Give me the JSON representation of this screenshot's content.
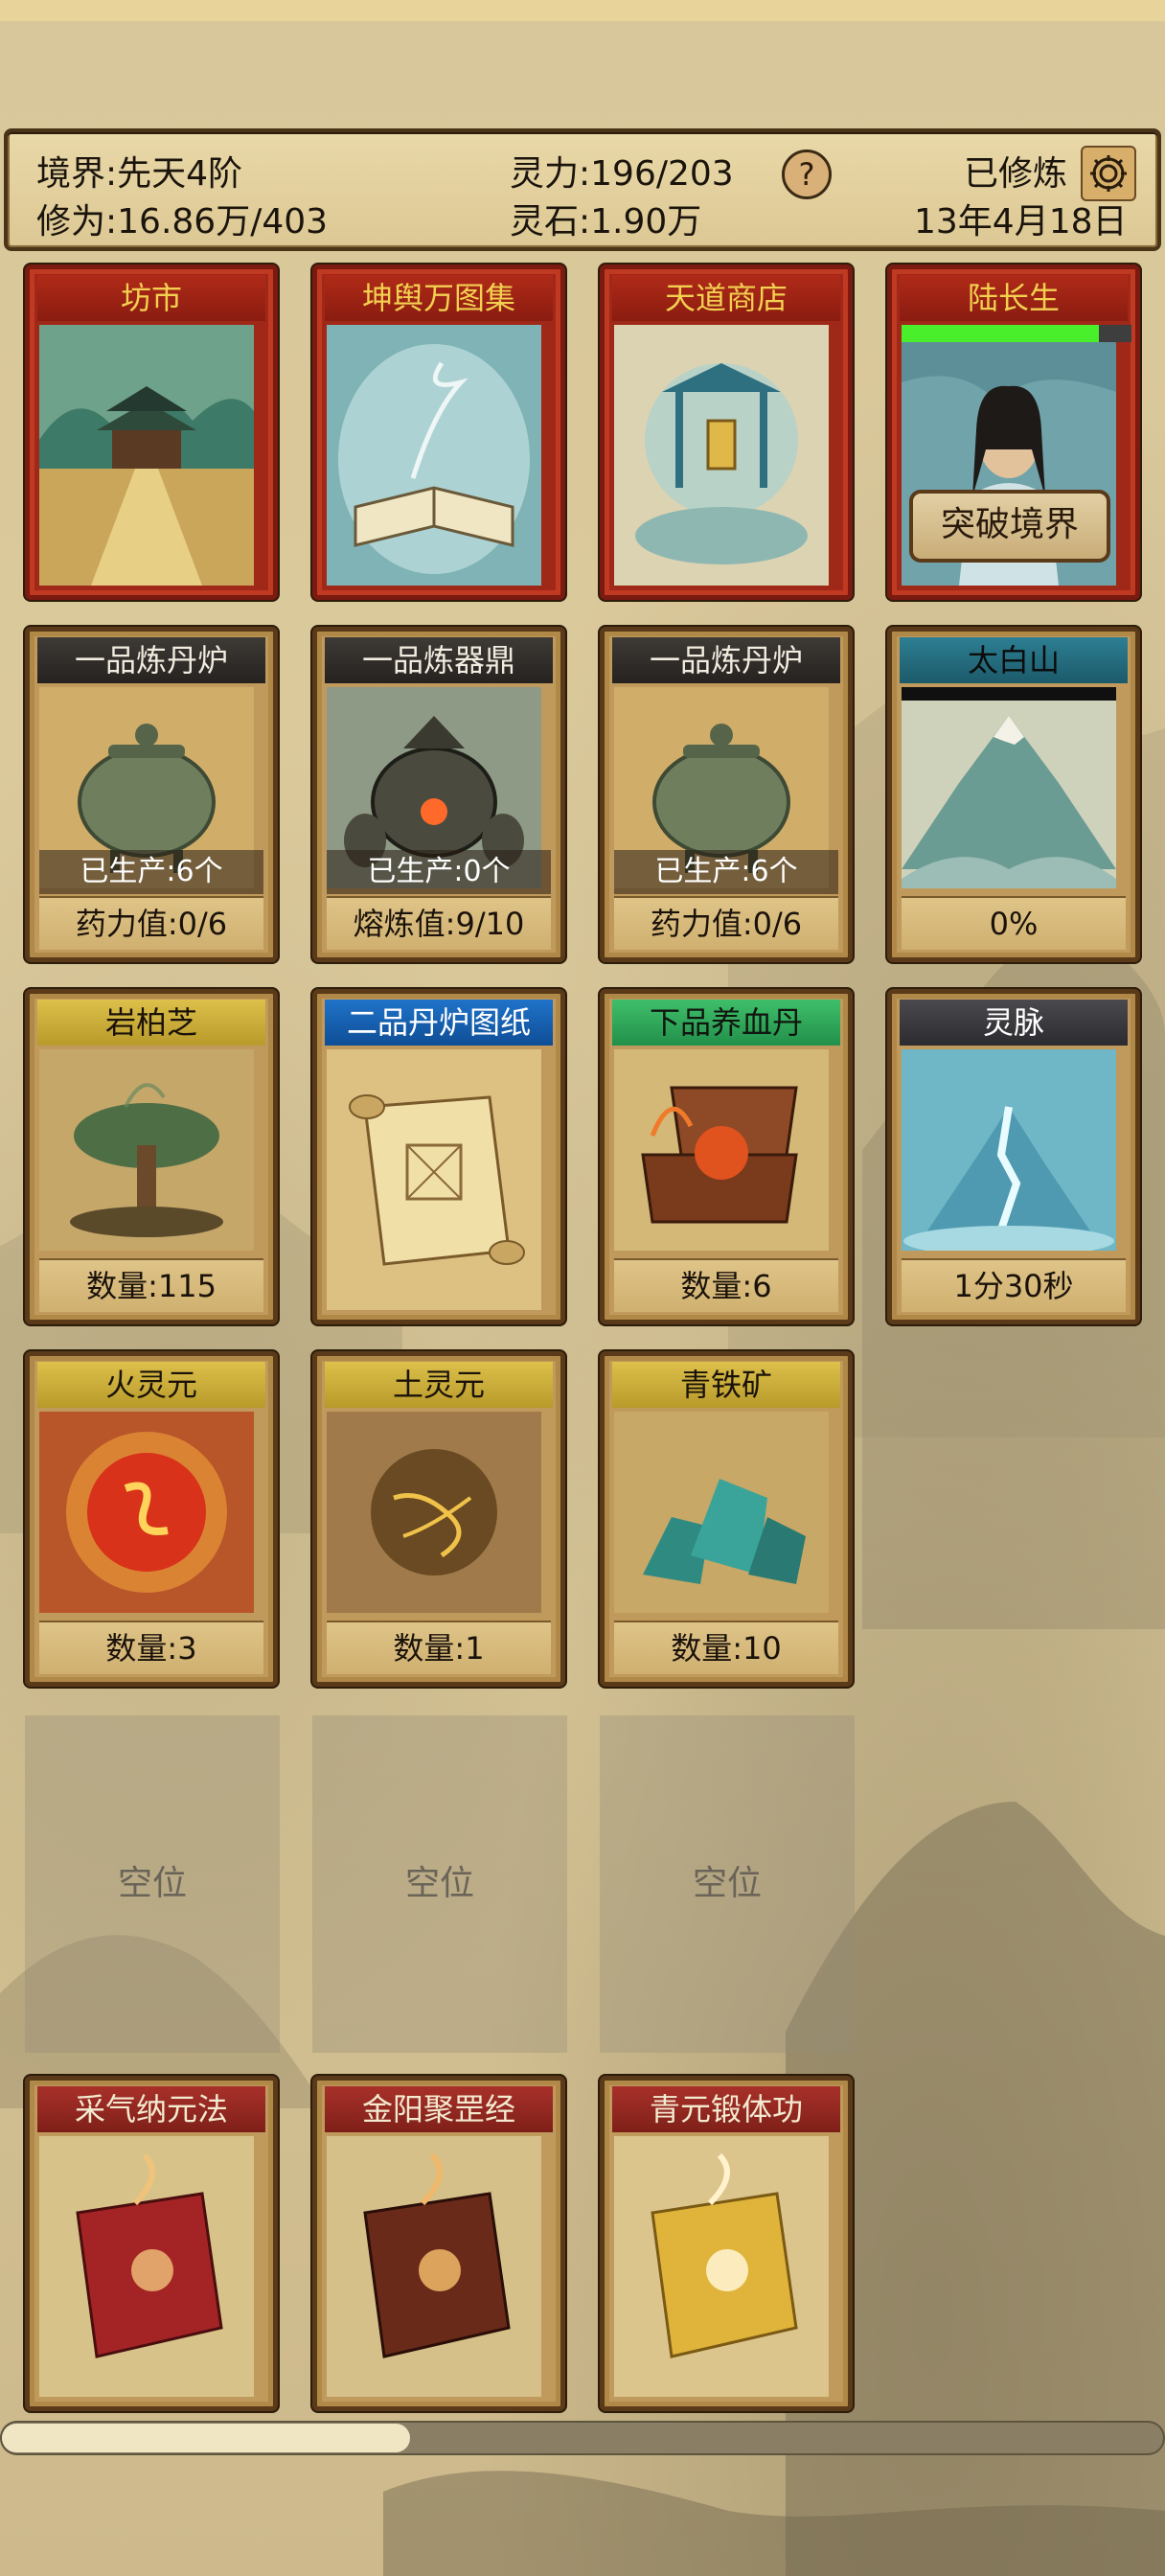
{
  "header": {
    "realm": "境界:先天4阶",
    "cultivation": "修为:16.86万/403",
    "spirit_power": "灵力:196/203",
    "spirit_stones": "灵石:1.90万",
    "help_label": "?",
    "status": "已修炼",
    "date": "13年4月18日",
    "gear_icon": "gear-icon"
  },
  "row1": [
    {
      "title": "坊市",
      "art": "market-pavilion"
    },
    {
      "title": "坤舆万图集",
      "art": "glowing-book"
    },
    {
      "title": "天道商店",
      "art": "shrine"
    },
    {
      "title": "陆长生",
      "art": "cultivator-portrait",
      "button": "突破境界",
      "progress": 0.86
    }
  ],
  "row2": [
    {
      "title": "一品炼丹炉",
      "produced": "已生产:6个",
      "footer": "药力值:0/6",
      "art": "alchemy-furnace"
    },
    {
      "title": "一品炼器鼎",
      "produced": "已生产:0个",
      "footer": "熔炼值:9/10",
      "art": "forging-cauldron"
    },
    {
      "title": "一品炼丹炉",
      "produced": "已生产:6个",
      "footer": "药力值:0/6",
      "art": "alchemy-furnace"
    },
    {
      "title": "太白山",
      "footer": "0%",
      "art": "mountain"
    }
  ],
  "row3": [
    {
      "title": "岩柏芝",
      "footer": "数量:115",
      "art": "mushroom"
    },
    {
      "title": "二品丹炉图纸",
      "footer": "",
      "art": "scroll"
    },
    {
      "title": "下品养血丹",
      "footer": "数量:6",
      "art": "pill-box"
    },
    {
      "title": "灵脉",
      "footer": "1分30秒",
      "art": "spirit-vein"
    }
  ],
  "row4": [
    {
      "title": "火灵元",
      "footer": "数量:3",
      "art": "fire-orb"
    },
    {
      "title": "土灵元",
      "footer": "数量:1",
      "art": "earth-orb"
    },
    {
      "title": "青铁矿",
      "footer": "数量:10",
      "art": "ore"
    }
  ],
  "empty_slots": [
    "空位",
    "空位",
    "空位"
  ],
  "row6": [
    {
      "title": "采气纳元法",
      "art": "red-book"
    },
    {
      "title": "金阳聚罡经",
      "art": "brown-book"
    },
    {
      "title": "青元锻体功",
      "art": "gold-book"
    }
  ],
  "scroll": {
    "position": 0.35
  },
  "colors": {
    "accent_red": "#a02818",
    "title_gold": "#f3d050",
    "parchment": "#d8c79a"
  }
}
